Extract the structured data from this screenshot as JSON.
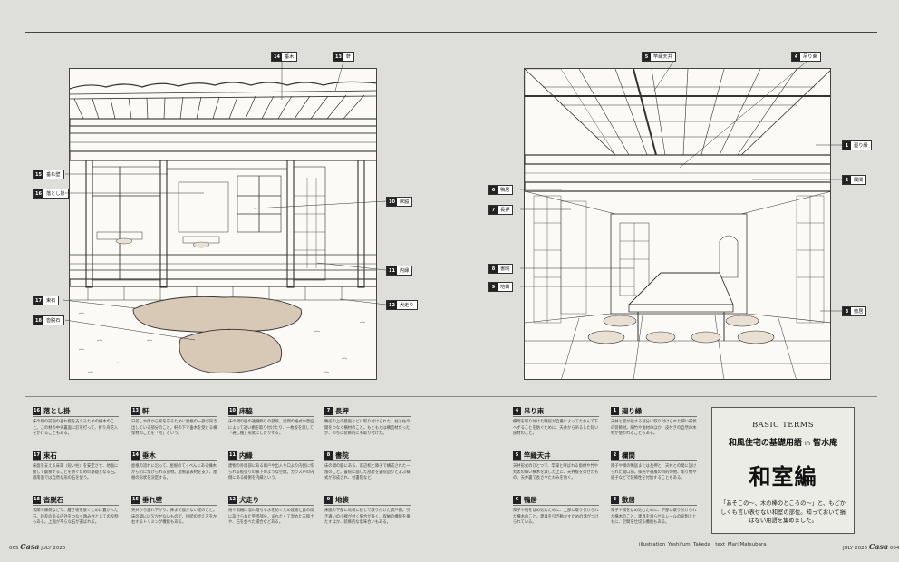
{
  "colors": {
    "page_bg": "#dededa",
    "ink": "#222222",
    "stone": "#d8c8b6",
    "cushion": "#e9e0d3",
    "paper": "#fbfaf6"
  },
  "left_labels": [
    {
      "num": "14",
      "text": "垂木"
    },
    {
      "num": "13",
      "text": "軒"
    },
    {
      "num": "15",
      "text": "垂れ壁"
    },
    {
      "num": "16",
      "text": "落とし掛"
    },
    {
      "num": "10",
      "text": "床脇"
    },
    {
      "num": "11",
      "text": "内縁"
    },
    {
      "num": "12",
      "text": "犬走り"
    },
    {
      "num": "17",
      "text": "束石"
    },
    {
      "num": "18",
      "text": "沓脱石"
    }
  ],
  "right_labels": [
    {
      "num": "5",
      "text": "竿縁天井"
    },
    {
      "num": "4",
      "text": "吊り束"
    },
    {
      "num": "1",
      "text": "廻り縁"
    },
    {
      "num": "2",
      "text": "欄間"
    },
    {
      "num": "6",
      "text": "鴨居"
    },
    {
      "num": "7",
      "text": "長押"
    },
    {
      "num": "8",
      "text": "書院"
    },
    {
      "num": "9",
      "text": "地袋"
    },
    {
      "num": "3",
      "text": "敷居"
    }
  ],
  "terms": [
    {
      "num": "16",
      "word": "落とし掛",
      "reading": "おとしがけ",
      "desc": "床の間の前面の垂れ壁を支えるための横木のこと。この材の中央裏面に釘を打って、折り舟花入をかけることもある。"
    },
    {
      "num": "17",
      "word": "束石",
      "reading": "つかいし",
      "desc": "床面を支える床束（短い柱）を安定させ、地面に接して腐食することを防ぐための基礎となる石。最南面では自然な形の石を使う。"
    },
    {
      "num": "18",
      "word": "沓脱石",
      "reading": "くつぬぎいし",
      "desc": "玄関や縁側などで、履き物を脱ぐために置かれた石。段差のある内外をつなぐ踏み台としての役割もある。上面が平らな石が選ばれる。"
    },
    {
      "num": "13",
      "word": "軒",
      "reading": "のき",
      "desc": "日差しや雨から家を守るために屋根の一部が突き出している部分のこと。軒の下で垂木を受ける横架材のことを「桁」という。"
    },
    {
      "num": "14",
      "word": "垂木",
      "reading": "たるき",
      "desc": "屋根の流れに沿って、屋根のてっぺんにある棟木から桁に架けられる部材。屋根裏表材を支え、屋根の形状を決定する。"
    },
    {
      "num": "15",
      "word": "垂れ壁",
      "reading": "たれかべ",
      "desc": "天井から垂れ下がり、床まで届かない壁のこと。床の間には欠かせないもので、接続の見え方を左右するトリミング機能もある。"
    },
    {
      "num": "10",
      "word": "床脇",
      "reading": "とこわき",
      "desc": "床の間の脇の違棚飾りの部取。空間の格式や意匠によって違い棚を取り付けたり、一枚板を渡して「通し棚」形式にしたりする。"
    },
    {
      "num": "11",
      "word": "内縁",
      "reading": "うちえん",
      "desc": "建物の外周部にある雨戸や出入り口より内側に作られる板張りの廊下のような空間。ガラス戸の内側にある縁側を内縁という。"
    },
    {
      "num": "12",
      "word": "犬走り",
      "reading": "いぬばしり",
      "desc": "雨や雨樋に溜れ落ちる水を防ぐため建物と庭の間に設けられた平坦部分。まれたくて湿めた三和土や、石を並べた場合などある。"
    },
    {
      "num": "7",
      "word": "長押",
      "reading": "なげし",
      "desc": "鴨居の上の壁面などに取り付けられた、柱と柱の間をつなぐ横材のこと。もともとは構造材だったが、のちに装飾的にも取り付けた。"
    },
    {
      "num": "8",
      "word": "書院",
      "reading": "しょいん",
      "desc": "床の間の脇にある、窓辺机と障子で構成された一角のこと。書院に面した部屋を書院造りとよぶ様式が形成され、付書院など。"
    },
    {
      "num": "9",
      "word": "地袋",
      "reading": "じぶくろ",
      "desc": "床脇の下部に地板に接して取り付けた袋戸棚。引き違いの小襖が付く場合が多く、収納の機能を果たすほか、装飾的な意味合いもある。"
    },
    {
      "num": "4",
      "word": "吊り束",
      "reading": "つりづか",
      "desc": "欄間を取り付けた鴨居が自重によってたわんで下へずることを防ぐために、天井から吊るした短い部材のこと。"
    },
    {
      "num": "5",
      "word": "竿縁天井",
      "reading": "さおぶちてんじょう",
      "desc": "天井形式のひとつで、竿縁と呼ばれる角材や竹や丸太の細い横木を渡した上に、天井板をのせたもの。天井裏で長さやたわみを防ぐ。"
    },
    {
      "num": "6",
      "word": "鴨居",
      "reading": "かもい",
      "desc": "障子や襖をはめ込むために、上部に取り付けられた横木のこと。建具を引き動かすための溝がつけられている。"
    },
    {
      "num": "1",
      "word": "廻り縁",
      "reading": "まわりぶち",
      "desc": "天井と壁が接する部分に取り付けられた細い帯状の装飾材。細竹や角材のほか、皮付きの自然の木材が使われることもある。"
    },
    {
      "num": "2",
      "word": "欄間",
      "reading": "らんま",
      "desc": "障子や襖の鴨居または長押と、天井との間に設けられた開口部。採光や通風の目的の他、彫り物や組子などで装飾性を付加することもある。"
    },
    {
      "num": "3",
      "word": "敷居",
      "reading": "しきい",
      "desc": "障子や襖をはめ込むために、下部に取り付けられた横木のこと。建具を滑らせるレールの役割とともに、空間を仕切る機能もある。"
    }
  ],
  "title_box": {
    "kicker": "BASIC TERMS",
    "subtitle_main": "和風住宅の基礎用語",
    "subtitle_in": "in",
    "subtitle_place": "智水庵",
    "title": "和室編",
    "intro": "「あそこの〜、木の棒のところの〜」と、もどかしくも言い表せない和室の部位。知っておいて損はない用語を集めました。"
  },
  "footer": {
    "left_page": "065",
    "left_logo": "Casa",
    "left_date": "JULY 2025",
    "credit_illustration": "illustration_Yoshifumi Takeda",
    "credit_text": "text_Mari Matsubara",
    "right_date": "JULY 2025",
    "right_logo": "Casa",
    "right_page": "064"
  }
}
